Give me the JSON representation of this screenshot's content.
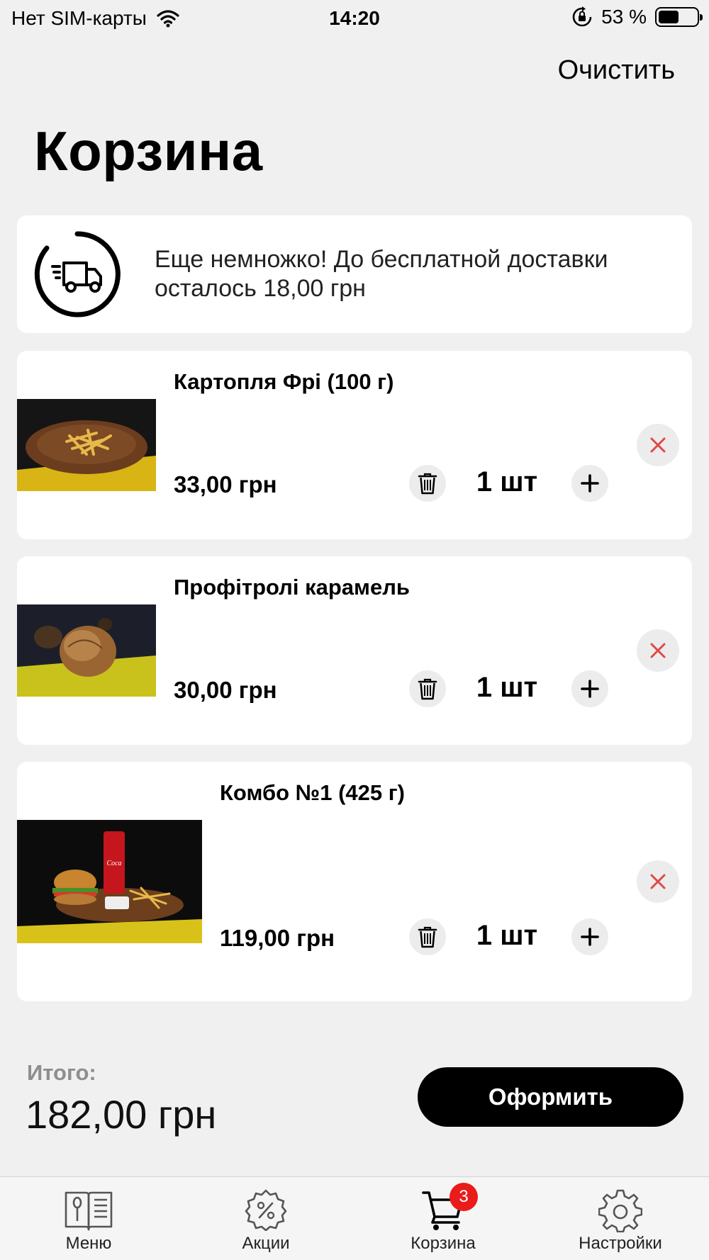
{
  "status_bar": {
    "carrier": "Нет SIM-карты",
    "time": "14:20",
    "battery": "53 %",
    "battery_level": 0.53
  },
  "header": {
    "clear_label": "Очистить",
    "title": "Корзина"
  },
  "delivery": {
    "message": "Еще немножко! До бесплатной доставки осталось 18,00 грн",
    "icon": "truck-icon"
  },
  "cart_items": [
    {
      "name": "Картопля Фрі (100 г)",
      "price": "33,00 грн",
      "quantity": "1 шт",
      "image": "fries-photo"
    },
    {
      "name": "Профітролі карамель",
      "price": "30,00 грн",
      "quantity": "1 шт",
      "image": "profiteroles-photo"
    },
    {
      "name": "Комбо №1 (425 г)",
      "price": "119,00 грн",
      "quantity": "1 шт",
      "image": "combo-photo"
    }
  ],
  "summary": {
    "total_label": "Итого:",
    "total_value": "182,00 грн",
    "checkout_label": "Оформить"
  },
  "tab_bar": {
    "tabs": [
      {
        "label": "Меню",
        "icon": "menu-book-icon"
      },
      {
        "label": "Акции",
        "icon": "discount-badge-icon"
      },
      {
        "label": "Корзина",
        "icon": "cart-icon",
        "badge": "3",
        "active": true
      },
      {
        "label": "Настройки",
        "icon": "gear-icon"
      }
    ]
  },
  "colors": {
    "background": "#f0f0f0",
    "card": "#ffffff",
    "accent": "#000000",
    "remove": "#e04848",
    "badge": "#ea1b1b"
  }
}
